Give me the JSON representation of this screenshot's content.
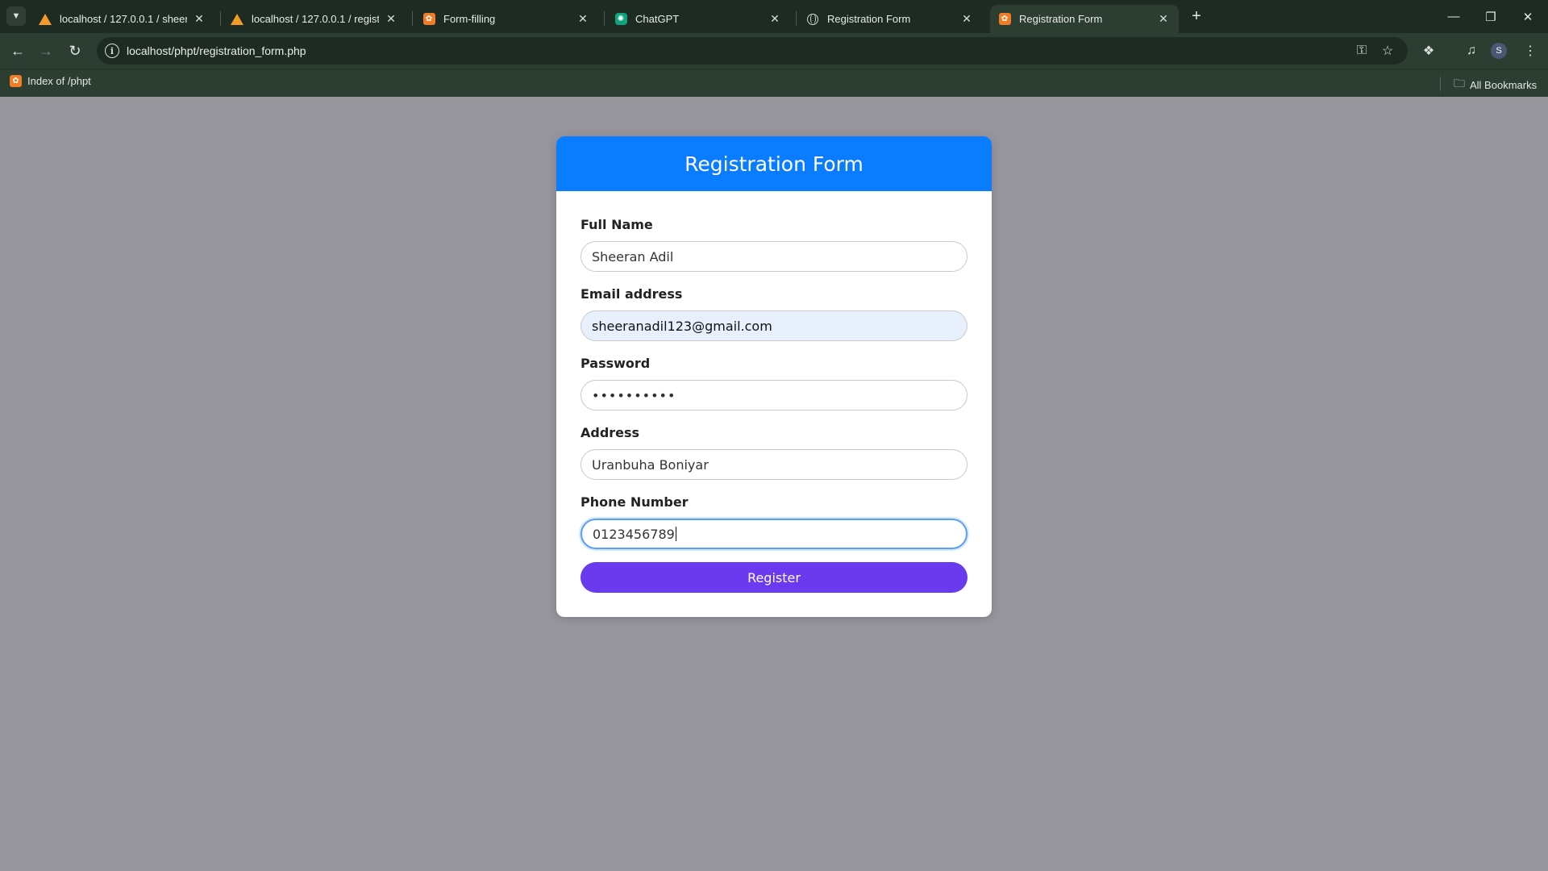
{
  "browser": {
    "tabs": [
      {
        "title": "localhost / 127.0.0.1 / sheeran",
        "icon": "phpmyadmin-icon",
        "active": false
      },
      {
        "title": "localhost / 127.0.0.1 / registrati",
        "icon": "phpmyadmin-icon",
        "active": false
      },
      {
        "title": "Form-filling",
        "icon": "xampp-icon",
        "active": false
      },
      {
        "title": "ChatGPT",
        "icon": "chatgpt-icon",
        "active": false
      },
      {
        "title": "Registration Form",
        "icon": "globe-icon",
        "active": false
      },
      {
        "title": "Registration Form",
        "icon": "xampp-icon",
        "active": true
      }
    ],
    "url": "localhost/phpt/registration_form.php",
    "bookmarks": [
      {
        "label": "Index of /phpt",
        "icon": "xampp-icon"
      }
    ],
    "all_bookmarks_label": "All Bookmarks",
    "profile_initial": "S"
  },
  "form": {
    "title": "Registration Form",
    "fields": {
      "full_name": {
        "label": "Full Name",
        "value": "Sheeran Adil"
      },
      "email": {
        "label": "Email address",
        "value": "sheeranadil123@gmail.com"
      },
      "password": {
        "label": "Password",
        "value": "••••••••••"
      },
      "address": {
        "label": "Address",
        "value": "Uranbuha Boniyar"
      },
      "phone": {
        "label": "Phone Number",
        "value": "0123456789"
      }
    },
    "submit_label": "Register"
  },
  "colors": {
    "header": "#0a7cff",
    "button": "#6b3aef",
    "page_bg": "#96959b",
    "chrome": "#2c3d31"
  }
}
